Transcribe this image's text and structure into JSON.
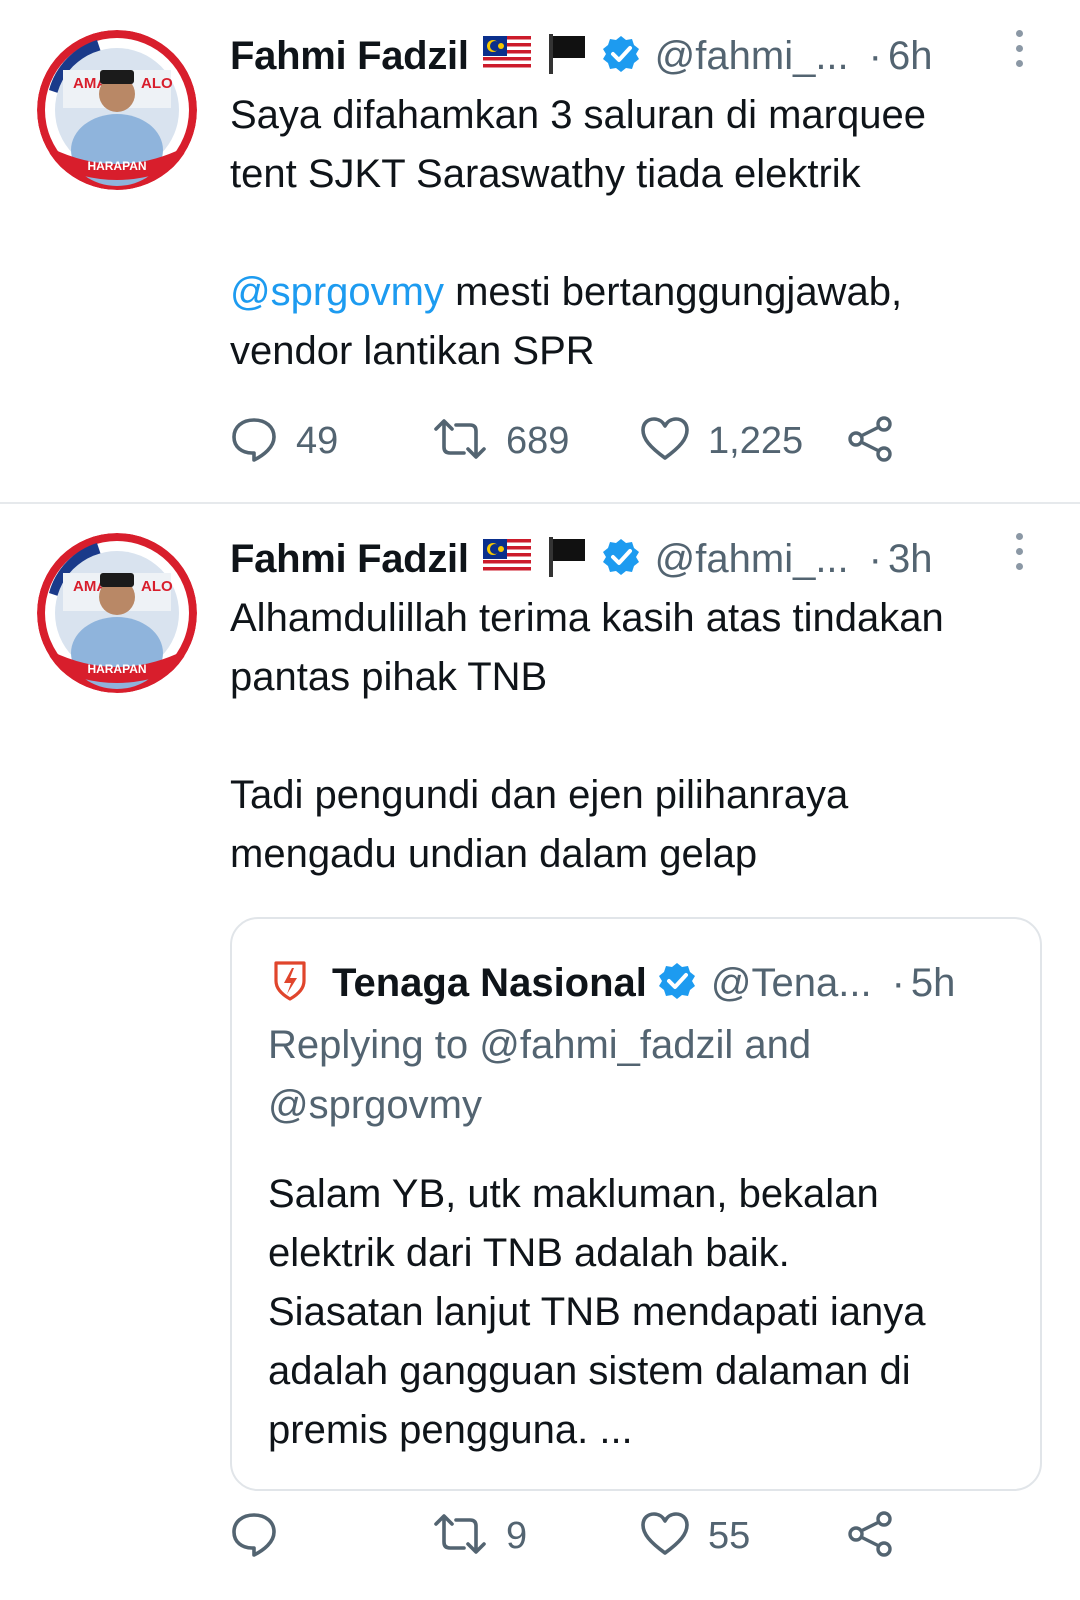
{
  "tweets": [
    {
      "name": "Fahmi Fadzil",
      "handle": "@fahmi_...",
      "dot": "·",
      "time": "6h",
      "text_lines": [
        "Saya difahamkan 3 saluran di marquee",
        "tent SJKT Saraswathy tiada elektrik"
      ],
      "mention": "@sprgovmy",
      "mention_rest": " mesti bertanggungjawab,",
      "text_line_after": "vendor lantikan SPR",
      "avatar_text": "HARAPAN",
      "counts": {
        "reply": "49",
        "retweet": "689",
        "like": "1,225"
      }
    },
    {
      "name": "Fahmi Fadzil",
      "handle": "@fahmi_...",
      "dot": "·",
      "time": "3h",
      "text_lines": [
        "Alhamdulillah terima kasih atas tindakan",
        "pantas pihak TNB"
      ],
      "text_lines2": [
        "Tadi pengundi dan ejen pilihanraya",
        "mengadu undian dalam gelap"
      ],
      "avatar_text": "HARAPAN",
      "counts": {
        "reply": "",
        "retweet": "9",
        "like": "55"
      },
      "quote": {
        "name": "Tenaga Nasional",
        "handle": "@Tena...",
        "dot": "·",
        "time": "5h",
        "reply_lines": [
          "Replying to @fahmi_fadzil and",
          "@sprgovmy"
        ],
        "text_lines": [
          "Salam YB, utk makluman, bekalan",
          "elektrik dari TNB adalah baik.",
          "Siasatan lanjut TNB mendapati ianya",
          "adalah gangguan sistem dalaman di",
          "premis pengguna. ..."
        ]
      }
    }
  ],
  "colors": {
    "accent": "#1d9bf0",
    "secondary": "#536471",
    "tnb": "#e0452c"
  },
  "icons": [
    "reply-icon",
    "retweet-icon",
    "like-icon",
    "share-icon",
    "more-icon",
    "verified-icon",
    "malaysia-flag-icon",
    "black-flag-icon",
    "tnb-logo-icon"
  ]
}
